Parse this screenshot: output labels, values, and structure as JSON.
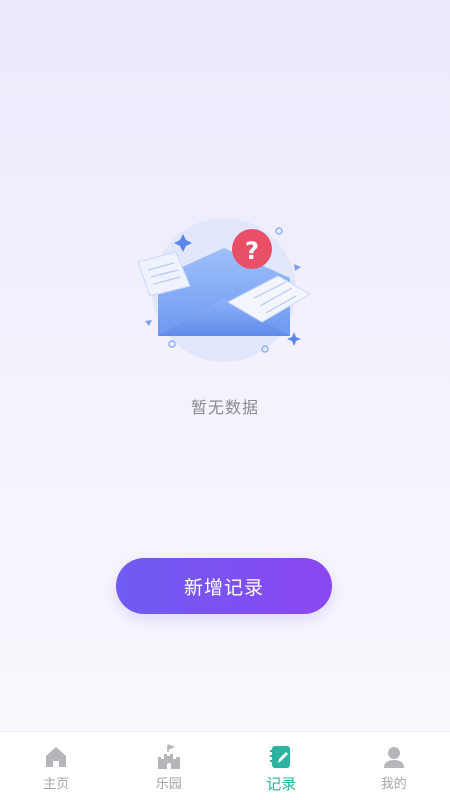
{
  "empty_state": {
    "message": "暂无数据"
  },
  "actions": {
    "add_record_label": "新增记录"
  },
  "tabbar": {
    "active_color": "#2bb3a0",
    "inactive_color": "#b5b5ba",
    "items": [
      {
        "label": "主页",
        "icon": "home-icon",
        "active": false
      },
      {
        "label": "乐园",
        "icon": "castle-icon",
        "active": false
      },
      {
        "label": "记录",
        "icon": "notebook-pen-icon",
        "active": true
      },
      {
        "label": "我的",
        "icon": "user-icon",
        "active": false
      }
    ]
  }
}
